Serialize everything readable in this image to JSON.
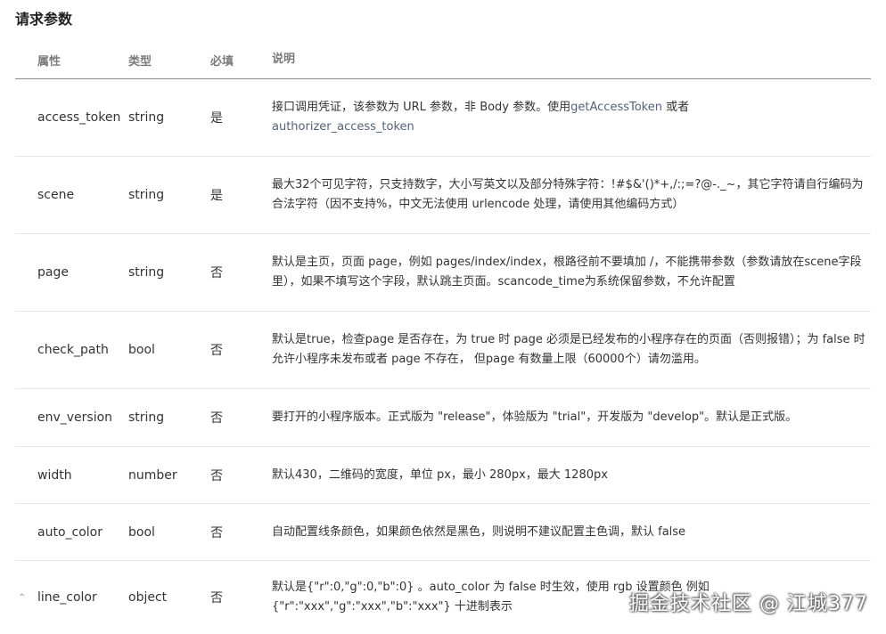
{
  "title": "请求参数",
  "headers": {
    "attr": "属性",
    "type": "类型",
    "required": "必填",
    "desc": "说明"
  },
  "rows": [
    {
      "name": "access_token",
      "type": "string",
      "required": "是",
      "desc_pre": "接口调用凭证，该参数为 URL 参数，非 Body 参数。使用",
      "desc_link1": "getAccessToken",
      "desc_mid": " 或者",
      "desc_link2": "authorizer_access_token"
    },
    {
      "name": "scene",
      "type": "string",
      "required": "是",
      "desc": "最大32个可见字符，只支持数字，大小写英文以及部分特殊字符：!#$&'()*+,/:;=?@-._~，其它字符请自行编码为合法字符（因不支持%，中文无法使用 urlencode 处理，请使用其他编码方式）"
    },
    {
      "name": "page",
      "type": "string",
      "required": "否",
      "desc": "默认是主页，页面 page，例如 pages/index/index，根路径前不要填加 /，不能携带参数（参数请放在scene字段里），如果不填写这个字段，默认跳主页面。scancode_time为系统保留参数，不允许配置"
    },
    {
      "name": "check_path",
      "type": "bool",
      "required": "否",
      "desc": "默认是true，检查page 是否存在，为 true 时 page 必须是已经发布的小程序存在的页面（否则报错）；为 false 时允许小程序未发布或者 page 不存在， 但page 有数量上限（60000个）请勿滥用。"
    },
    {
      "name": "env_version",
      "type": "string",
      "required": "否",
      "desc": "要打开的小程序版本。正式版为 \"release\"，体验版为 \"trial\"，开发版为 \"develop\"。默认是正式版。"
    },
    {
      "name": "width",
      "type": "number",
      "required": "否",
      "desc": "默认430，二维码的宽度，单位 px，最小 280px，最大 1280px"
    },
    {
      "name": "auto_color",
      "type": "bool",
      "required": "否",
      "desc": "自动配置线条颜色，如果颜色依然是黑色，则说明不建议配置主色调，默认 false"
    },
    {
      "name": "line_color",
      "type": "object",
      "required": "否",
      "desc": "默认是{\"r\":0,\"g\":0,\"b\":0} 。auto_color 为 false 时生效，使用 rgb 设置颜色 例如 {\"r\":\"xxx\",\"g\":\"xxx\",\"b\":\"xxx\"} 十进制表示"
    }
  ],
  "expand_icon": "chevron-up-icon",
  "watermark": "掘金技术社区 @ 江城377",
  "colors": {
    "link": "#52637a",
    "header_text": "#7a7a7a",
    "body_text": "#333333",
    "divider": "#e6e6e6"
  }
}
